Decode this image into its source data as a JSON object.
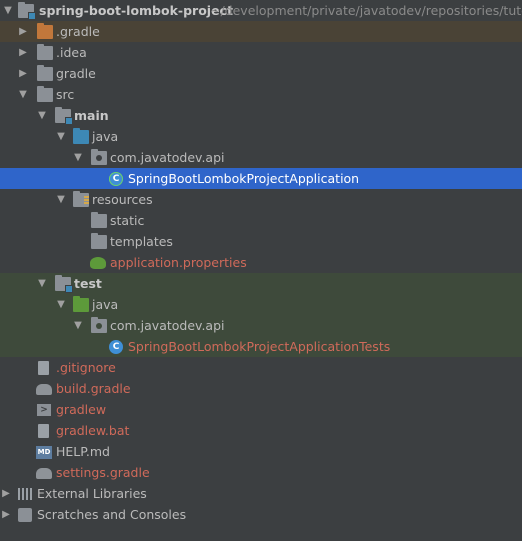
{
  "project_view": {
    "root": {
      "name": "spring-boot-lombok-project",
      "path": "~/development/private/javatodev/repositories/tutorials/s"
    },
    "items": [
      {
        "label": ".gradle"
      },
      {
        "label": ".idea"
      },
      {
        "label": "gradle"
      },
      {
        "label": "src"
      },
      {
        "label": "main"
      },
      {
        "label": "java"
      },
      {
        "label": "com.javatodev.api"
      },
      {
        "label": "SpringBootLombokProjectApplication"
      },
      {
        "label": "resources"
      },
      {
        "label": "static"
      },
      {
        "label": "templates"
      },
      {
        "label": "application.properties"
      },
      {
        "label": "test"
      },
      {
        "label": "java"
      },
      {
        "label": "com.javatodev.api"
      },
      {
        "label": "SpringBootLombokProjectApplicationTests"
      },
      {
        "label": ".gitignore"
      },
      {
        "label": "build.gradle"
      },
      {
        "label": "gradlew"
      },
      {
        "label": "gradlew.bat"
      },
      {
        "label": "HELP.md"
      },
      {
        "label": "settings.gradle"
      },
      {
        "label": "External Libraries"
      },
      {
        "label": "Scratches and Consoles"
      }
    ]
  },
  "colors": {
    "background": "#3c3f41",
    "selection": "#2f65ca",
    "modified_file": "#d06a5a",
    "excluded_folder_bg": "#4a4336",
    "test_folder_bg": "#3e4a3b"
  },
  "icons": {
    "expanded": "chevron-down-icon",
    "collapsed": "chevron-right-icon",
    "folder": "folder-icon",
    "package": "package-icon",
    "class": "java-class-icon"
  }
}
